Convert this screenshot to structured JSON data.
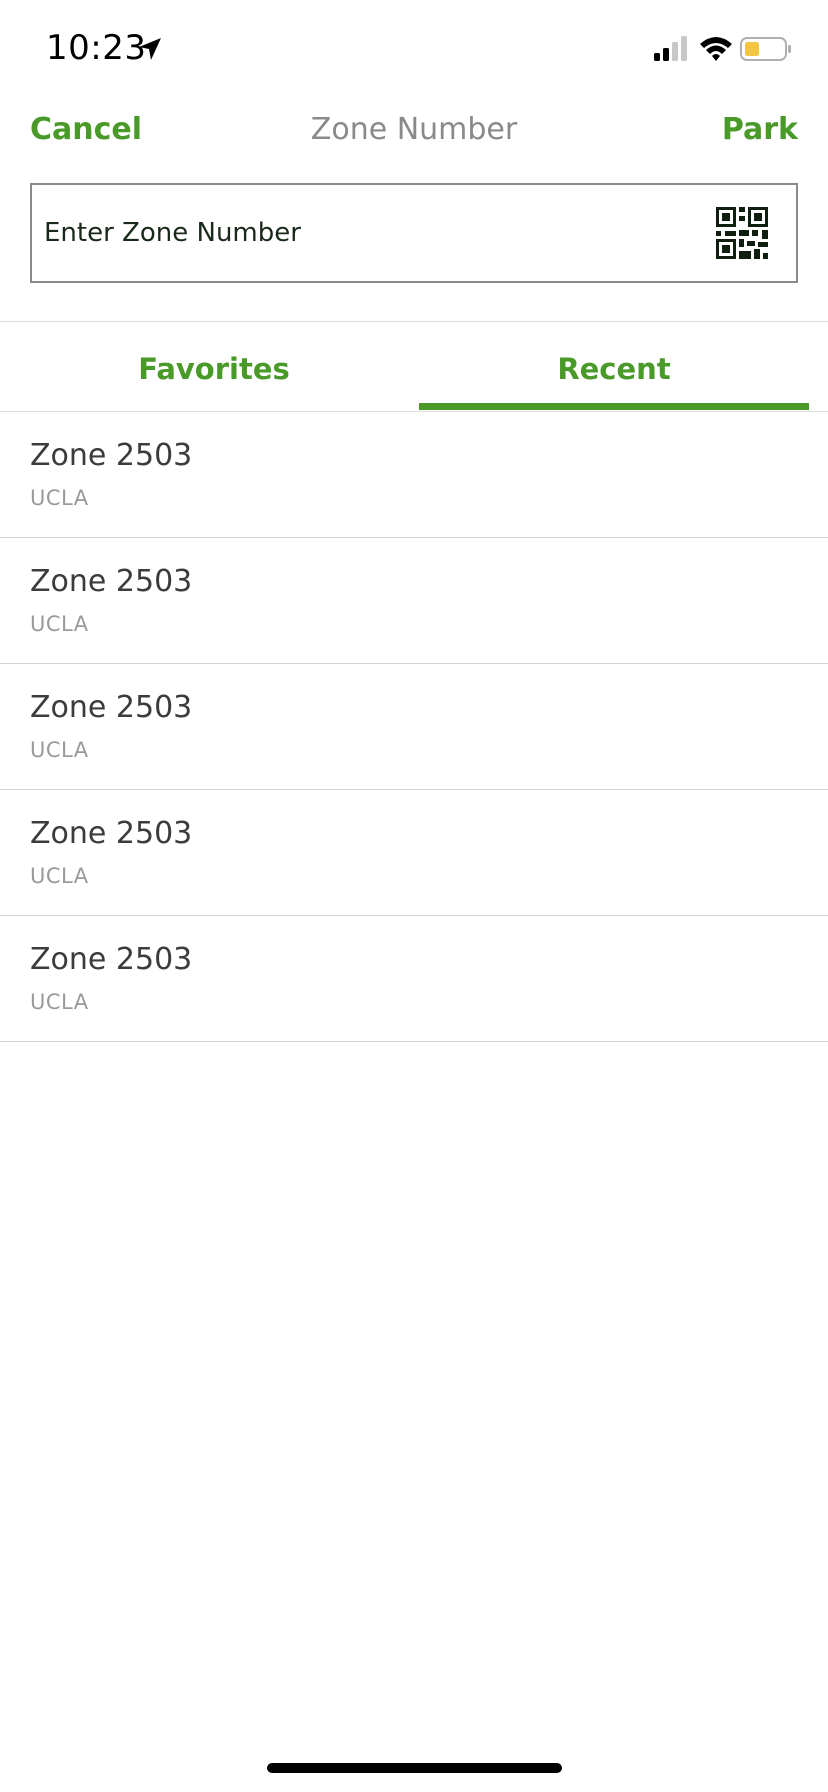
{
  "status_bar": {
    "time": "10:23",
    "icons": [
      "location-arrow-icon",
      "cellular-signal-icon",
      "wifi-icon",
      "battery-icon"
    ],
    "battery_color": "#f4c542"
  },
  "nav": {
    "cancel_label": "Cancel",
    "title": "Zone Number",
    "park_label": "Park"
  },
  "search": {
    "placeholder": "Enter Zone Number",
    "value": "",
    "scan_icon": "qr-code-icon"
  },
  "tabs": [
    {
      "label": "Favorites",
      "active": false
    },
    {
      "label": "Recent",
      "active": true
    }
  ],
  "recent_zones": [
    {
      "title": "Zone 2503",
      "subtitle": "UCLA"
    },
    {
      "title": "Zone 2503",
      "subtitle": "UCLA"
    },
    {
      "title": "Zone 2503",
      "subtitle": "UCLA"
    },
    {
      "title": "Zone 2503",
      "subtitle": "UCLA"
    },
    {
      "title": "Zone 2503",
      "subtitle": "UCLA"
    }
  ],
  "colors": {
    "accent": "#4a9a2a",
    "title_gray": "#8a8a8a",
    "subtitle_gray": "#9a9a9a",
    "divider": "#d4d4d4"
  }
}
